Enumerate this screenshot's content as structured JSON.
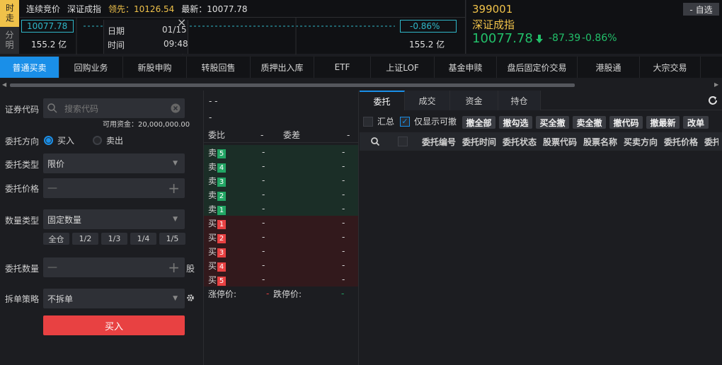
{
  "mini_quote": {
    "tab_time": "时走",
    "tab_min": "分明",
    "mode": "连续竞价",
    "index_name": "深证成指",
    "lead_label": "领先：10126.54",
    "latest_label": "最新：10077.78",
    "price_tag": "10077.78",
    "pct_tag": "-0.86%",
    "vol_left": "155.2 亿",
    "vol_right": "155.2 亿",
    "tip_date_label": "日期",
    "tip_date": "01/15",
    "tip_time_label": "时间",
    "tip_time": "09:48",
    "close_icon": "×"
  },
  "quote": {
    "code": "399001",
    "name": "深证成指",
    "price": "10077.78",
    "arrow": "down-arrow-icon",
    "change": "-87.39",
    "pct": "-0.86%",
    "watch_btn": "- 自选"
  },
  "nav": {
    "items": [
      "普通买卖",
      "回购业务",
      "新股申购",
      "转股回售",
      "质押出入库",
      "ETF",
      "上证LOF",
      "基金申赎",
      "盘后固定价交易",
      "港股通",
      "大宗交易"
    ]
  },
  "form": {
    "code_label": "证券代码",
    "code_placeholder": "搜索代码",
    "avail": "可用资金：20,000,000.00",
    "dir_label": "委托方向",
    "buy": "买入",
    "sell": "卖出",
    "type_label": "委托类型",
    "type_value": "限价",
    "price_label": "委托价格",
    "qty_type_label": "数量类型",
    "qty_type_value": "固定数量",
    "fractions": [
      "全仓",
      "1/2",
      "1/3",
      "1/4",
      "1/5"
    ],
    "qty_label": "委托数量",
    "unit": "股",
    "split_label": "拆单策略",
    "split_value": "不拆单",
    "buy_button": "买入",
    "minus": "—",
    "plus": "+"
  },
  "orderbook": {
    "top1": "-  -",
    "top2": "-",
    "ratio_label": "委比",
    "ratio_val": "-",
    "diff_label": "委差",
    "diff_val": "-",
    "sells": [
      {
        "label": "卖",
        "n": "5",
        "price": "-",
        "vol": "-"
      },
      {
        "label": "卖",
        "n": "4",
        "price": "-",
        "vol": "-"
      },
      {
        "label": "卖",
        "n": "3",
        "price": "-",
        "vol": "-"
      },
      {
        "label": "卖",
        "n": "2",
        "price": "-",
        "vol": "-"
      },
      {
        "label": "卖",
        "n": "1",
        "price": "-",
        "vol": "-"
      }
    ],
    "buys": [
      {
        "label": "买",
        "n": "1",
        "price": "-",
        "vol": "-"
      },
      {
        "label": "买",
        "n": "2",
        "price": "-",
        "vol": "-"
      },
      {
        "label": "买",
        "n": "3",
        "price": "-",
        "vol": "-"
      },
      {
        "label": "买",
        "n": "4",
        "price": "-",
        "vol": "-"
      },
      {
        "label": "买",
        "n": "5",
        "price": "-",
        "vol": "-"
      }
    ],
    "limit_up": "涨停价:",
    "limit_up_val": "-",
    "limit_down": "跌停价:",
    "limit_down_val": "-"
  },
  "orders": {
    "tabs": [
      "委托",
      "成交",
      "资金",
      "持仓"
    ],
    "summary": "汇总",
    "only_cancelable": "仅显示可撤",
    "buttons": [
      "撤全部",
      "撤勾选",
      "买全撤",
      "卖全撤",
      "撤代码",
      "撤最新",
      "改单"
    ],
    "columns": [
      "委托编号",
      "委托时间",
      "委托状态",
      "股票代码",
      "股票名称",
      "买卖方向",
      "委托价格",
      "委托"
    ]
  },
  "colors": {
    "accent": "#1a8fe8",
    "up": "#e84142",
    "down": "#22a664",
    "highlight": "#f0c24a",
    "teal": "#2fb7c8"
  }
}
